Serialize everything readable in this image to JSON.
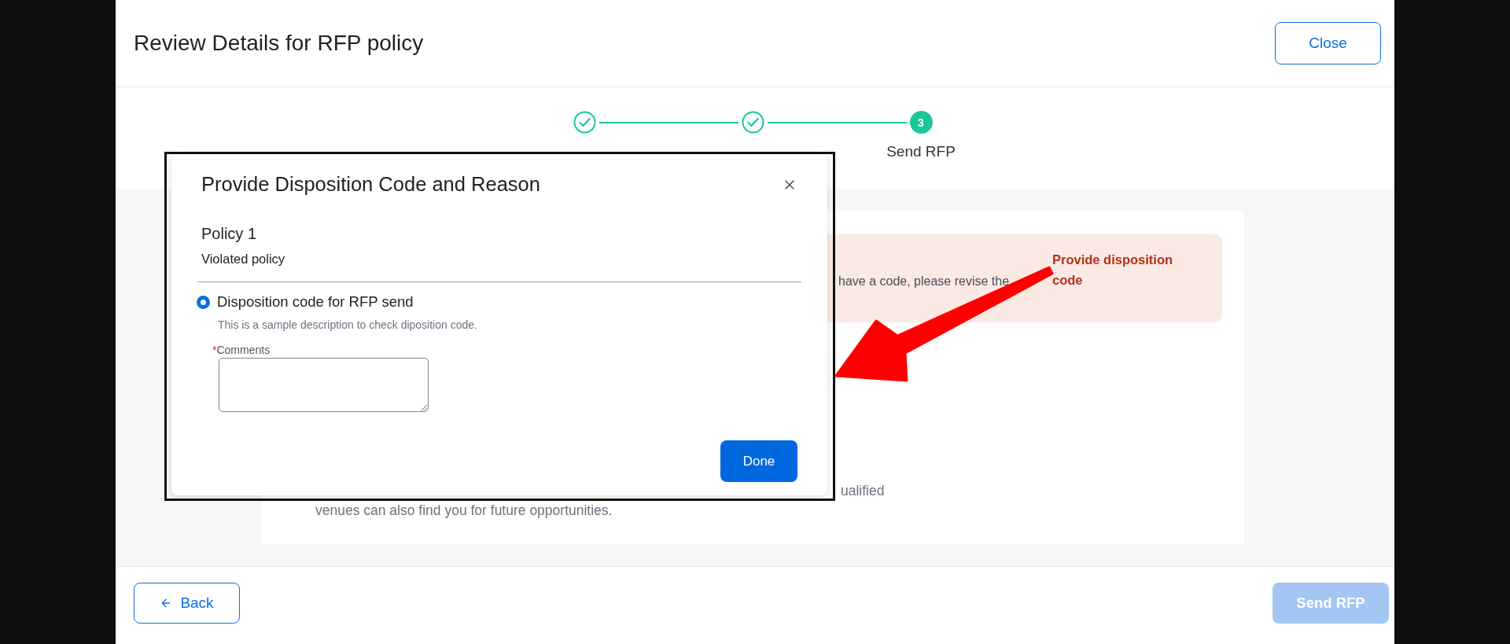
{
  "header": {
    "title": "Review Details for RFP policy",
    "close_button": "Close"
  },
  "stepper": {
    "steps": [
      {
        "completed": true,
        "selected": false
      },
      {
        "completed": true,
        "selected": false
      },
      {
        "completed": false,
        "selected": true,
        "number": "3",
        "label": "Send RFP"
      }
    ]
  },
  "alert": {
    "message": "have a code, please revise the",
    "action": "Provide disposition code"
  },
  "description": {
    "lines": [
      "ualified",
      "venues can also find you for future opportunities."
    ]
  },
  "modal": {
    "title": "Provide Disposition Code and Reason",
    "policy_title": "Policy 1",
    "policy_subtitle": "Violated policy",
    "options": [
      {
        "label": "Disposition code for RFP send",
        "description": "This is a sample description to check diposition code.",
        "selected": true
      }
    ],
    "comments": {
      "required_mark": "*",
      "label": "Comments"
    },
    "done_button": "Done"
  },
  "footer": {
    "back_button": "Back",
    "send_button": {
      "label": "Send RFP",
      "disabled": true
    }
  }
}
